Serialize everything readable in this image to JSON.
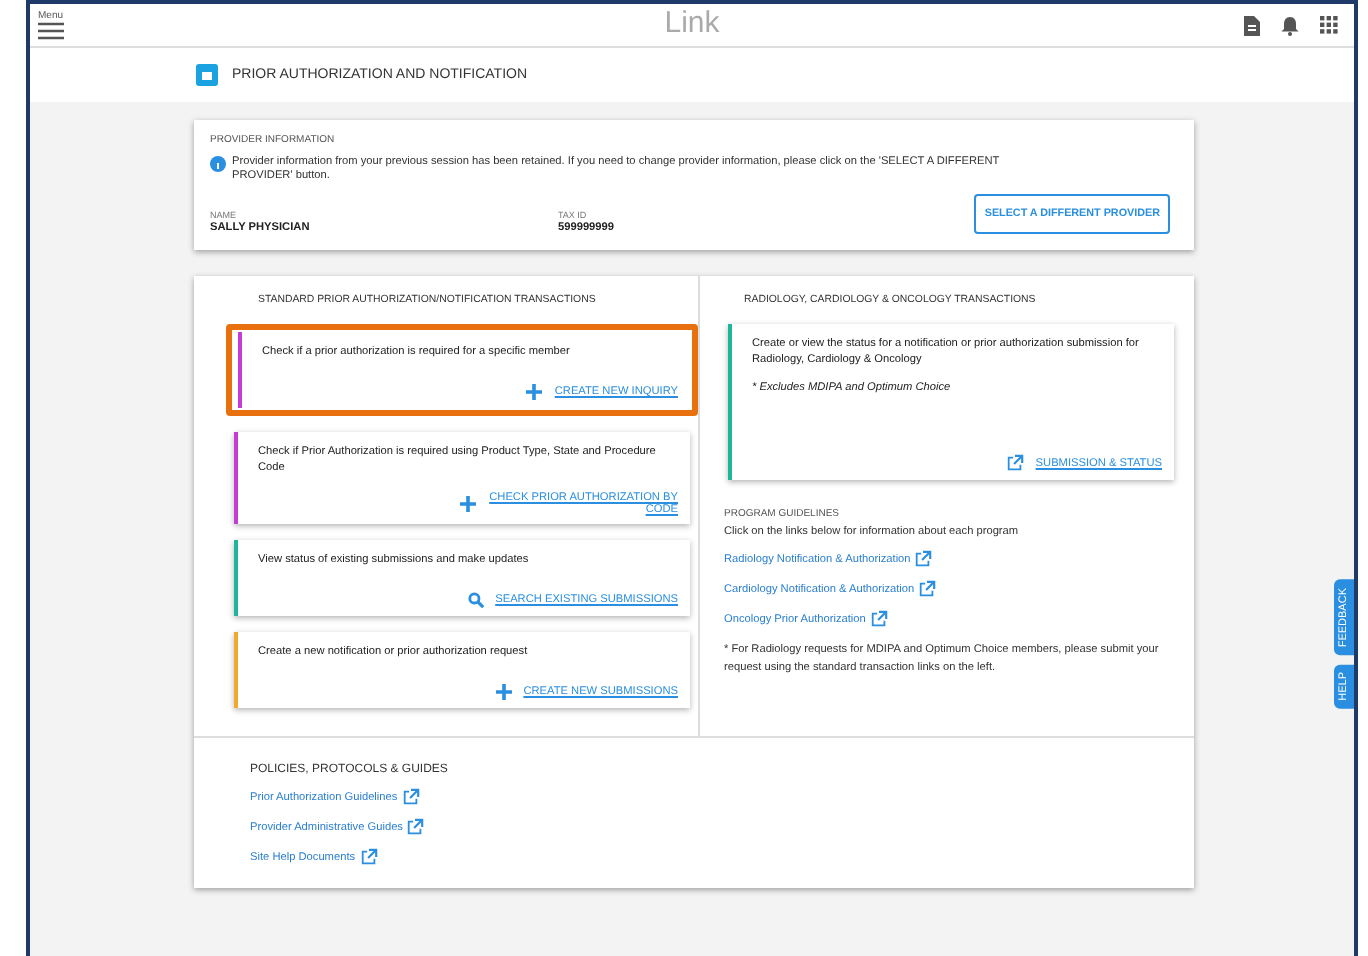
{
  "header": {
    "menu_label": "Menu",
    "logo": "Link"
  },
  "page_title": "PRIOR AUTHORIZATION AND NOTIFICATION",
  "provider": {
    "heading": "PROVIDER INFORMATION",
    "notice": "Provider information from your previous session has been retained. If you need to change provider information, please click on the 'SELECT A DIFFERENT PROVIDER' button.",
    "name_label": "NAME",
    "name": "SALLY PHYSICIAN",
    "tax_label": "TAX ID",
    "tax_id": "599999999",
    "button": "SELECT A DIFFERENT PROVIDER"
  },
  "standard": {
    "heading": "STANDARD PRIOR AUTHORIZATION/NOTIFICATION TRANSACTIONS",
    "items": [
      {
        "text": "Check if a prior authorization is required for a specific member",
        "action": "CREATE NEW INQUIRY",
        "kind": "plus",
        "color": "#c43cd6",
        "highlighted": true
      },
      {
        "text": "Check if Prior Authorization is required using Product Type, State and Procedure Code",
        "action": "CHECK PRIOR AUTHORIZATION BY CODE",
        "kind": "plus",
        "color": "#c43cd6",
        "highlighted": false
      },
      {
        "text": "View status of existing submissions and make updates",
        "action": "SEARCH EXISTING SUBMISSIONS",
        "kind": "search",
        "color": "#1fb59b",
        "highlighted": false
      },
      {
        "text": "Create a new notification or prior authorization request",
        "action": "CREATE NEW SUBMISSIONS",
        "kind": "plus",
        "color": "#f0a92c",
        "highlighted": false
      }
    ]
  },
  "rco": {
    "heading": "RADIOLOGY, CARDIOLOGY & ONCOLOGY TRANSACTIONS",
    "card": {
      "text": "Create or view the status for a notification or prior authorization submission for Radiology, Cardiology & Oncology",
      "note": "* Excludes MDIPA and Optimum Choice",
      "action": "SUBMISSION & STATUS",
      "color": "#1fb59b"
    },
    "guidelines_heading": "PROGRAM GUIDELINES",
    "guidelines_intro": "Click on the links below for information about each program",
    "links": [
      "Radiology Notification & Authorization",
      "Cardiology Notification & Authorization",
      "Oncology Prior Authorization"
    ],
    "footnote": "* For Radiology requests for MDIPA and Optimum Choice members, please submit your request using the standard transaction links on the left."
  },
  "policies": {
    "heading": "POLICIES, PROTOCOLS & GUIDES",
    "links": [
      "Prior Authorization Guidelines",
      "Provider Administrative Guides",
      "Site Help Documents"
    ]
  },
  "side_tabs": [
    "FEEDBACK",
    "HELP"
  ]
}
